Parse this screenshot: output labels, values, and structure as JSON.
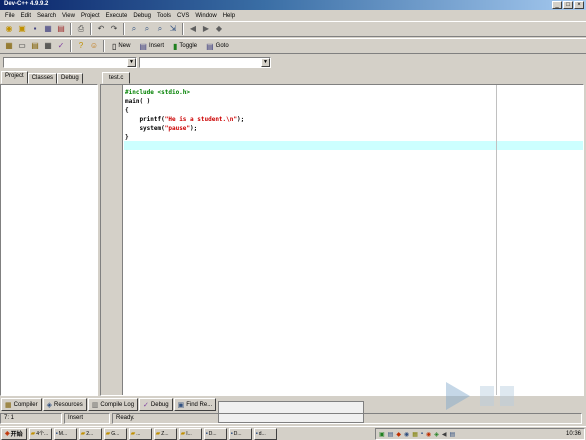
{
  "window": {
    "title": "Dev-C++ 4.9.9.2"
  },
  "menu": [
    "File",
    "Edit",
    "Search",
    "View",
    "Project",
    "Execute",
    "Debug",
    "Tools",
    "CVS",
    "Window",
    "Help"
  ],
  "toolbar2": {
    "new_label": "New",
    "insert_label": "Insert",
    "toggle_label": "Toggle",
    "goto_label": "Goto"
  },
  "left_tabs": [
    "Project",
    "Classes",
    "Debug"
  ],
  "file_tab": "test.c",
  "code": [
    {
      "parts": [
        {
          "cls": "pp",
          "text": "#include <stdio.h>"
        }
      ]
    },
    {
      "parts": [
        {
          "cls": "plain",
          "text": "main( )"
        }
      ]
    },
    {
      "parts": [
        {
          "cls": "plain",
          "text": "{"
        }
      ]
    },
    {
      "parts": [
        {
          "cls": "plain",
          "text": "    printf("
        },
        {
          "cls": "str",
          "text": "\"He is a student.\\n\""
        },
        {
          "cls": "plain",
          "text": ");"
        }
      ]
    },
    {
      "parts": [
        {
          "cls": "plain",
          "text": "    system("
        },
        {
          "cls": "str",
          "text": "\"pause\""
        },
        {
          "cls": "plain",
          "text": ");"
        }
      ]
    },
    {
      "parts": [
        {
          "cls": "plain",
          "text": "}"
        }
      ]
    }
  ],
  "bottom_tabs": {
    "compiler": "Compiler",
    "resources": "Resources",
    "compile_log": "Compile Log",
    "debug": "Debug",
    "find": "Find Re..."
  },
  "status": {
    "position": "7: 1",
    "mode": "Insert",
    "message": "Ready."
  },
  "taskbar": {
    "start": "开始",
    "tasks": [
      "4个...",
      "M...",
      "2...",
      "G...",
      "...",
      "Z...",
      "I...",
      "D...",
      "D...",
      "d..."
    ],
    "clock": "10:36"
  },
  "colors": {
    "title_start": "#0a246a",
    "title_end": "#a6caf0",
    "active_line": "#ccffff",
    "preprocessor": "#008000",
    "string": "#cc0000"
  }
}
